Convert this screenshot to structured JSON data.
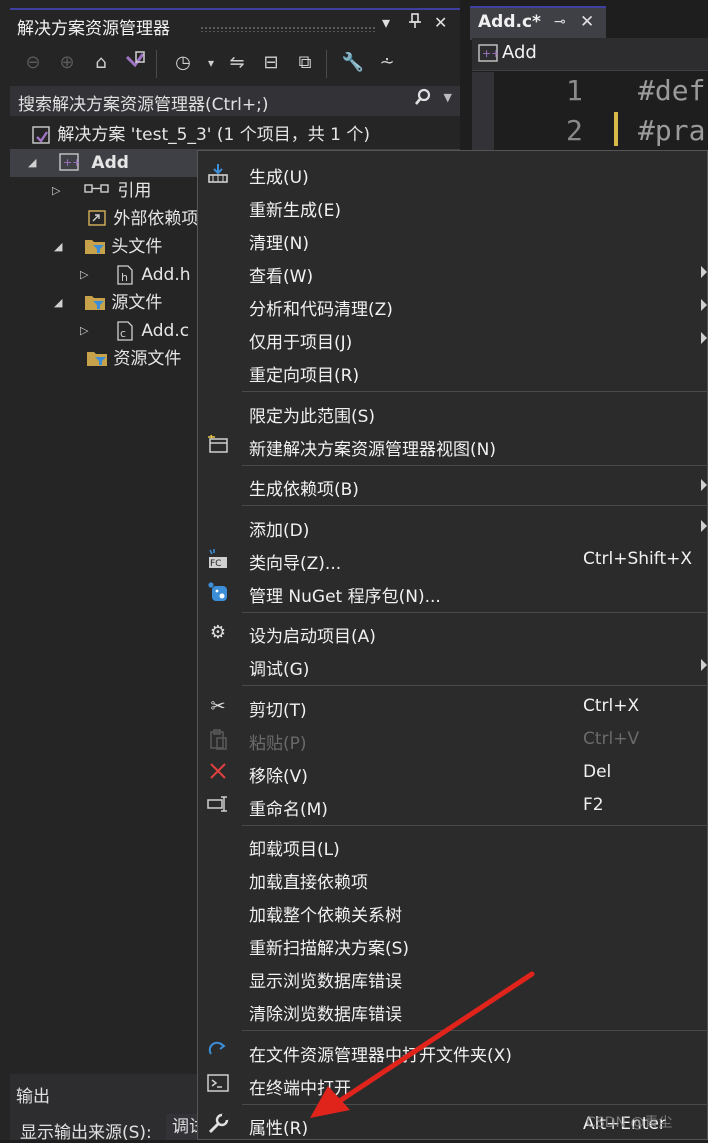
{
  "explorer": {
    "title": "解决方案资源管理器",
    "search_placeholder": "搜索解决方案资源管理器(Ctrl+;)",
    "solution_label": "解决方案 'test_5_3' (1 个项目，共 1 个)",
    "tree": [
      {
        "label": "Add"
      },
      {
        "label": "引用"
      },
      {
        "label": "外部依赖项"
      },
      {
        "label": "头文件"
      },
      {
        "label": "Add.h"
      },
      {
        "label": "源文件"
      },
      {
        "label": "Add.c"
      },
      {
        "label": "资源文件"
      }
    ]
  },
  "editor": {
    "tab_name": "Add.c*",
    "nav_project": "Add",
    "lines": [
      {
        "num": "1",
        "code": "#def"
      },
      {
        "num": "2",
        "code": "#pra"
      }
    ]
  },
  "output": {
    "title": "输出",
    "source_label": "显示输出来源(S):",
    "source_value": "调试"
  },
  "menu": {
    "items": [
      {
        "label": "生成(U)",
        "shortcut": ""
      },
      {
        "label": "重新生成(E)",
        "shortcut": ""
      },
      {
        "label": "清理(N)",
        "shortcut": ""
      },
      {
        "label": "查看(W)",
        "shortcut": ""
      },
      {
        "label": "分析和代码清理(Z)",
        "shortcut": ""
      },
      {
        "label": "仅用于项目(J)",
        "shortcut": ""
      },
      {
        "label": "重定向项目(R)",
        "shortcut": ""
      },
      {
        "label": "限定为此范围(S)",
        "shortcut": ""
      },
      {
        "label": "新建解决方案资源管理器视图(N)",
        "shortcut": ""
      },
      {
        "label": "生成依赖项(B)",
        "shortcut": ""
      },
      {
        "label": "添加(D)",
        "shortcut": ""
      },
      {
        "label": "类向导(Z)...",
        "shortcut": "Ctrl+Shift+X"
      },
      {
        "label": "管理 NuGet 程序包(N)...",
        "shortcut": ""
      },
      {
        "label": "设为启动项目(A)",
        "shortcut": ""
      },
      {
        "label": "调试(G)",
        "shortcut": ""
      },
      {
        "label": "剪切(T)",
        "shortcut": "Ctrl+X"
      },
      {
        "label": "粘贴(P)",
        "shortcut": "Ctrl+V"
      },
      {
        "label": "移除(V)",
        "shortcut": "Del"
      },
      {
        "label": "重命名(M)",
        "shortcut": "F2"
      },
      {
        "label": "卸载项目(L)",
        "shortcut": ""
      },
      {
        "label": "加载直接依赖项",
        "shortcut": ""
      },
      {
        "label": "加载整个依赖关系树",
        "shortcut": ""
      },
      {
        "label": "重新扫描解决方案(S)",
        "shortcut": ""
      },
      {
        "label": "显示浏览数据库错误",
        "shortcut": ""
      },
      {
        "label": "清除浏览数据库错误",
        "shortcut": ""
      },
      {
        "label": "在文件资源管理器中打开文件夹(X)",
        "shortcut": ""
      },
      {
        "label": "在终端中打开",
        "shortcut": ""
      },
      {
        "label": "属性(R)",
        "shortcut": "Alt+Enter"
      }
    ]
  },
  "watermark": "CSDN @青尘",
  "colors": {
    "accent": "#3f3f9f",
    "arrow": "#e0241b",
    "vs_purple": "#a074c4"
  }
}
